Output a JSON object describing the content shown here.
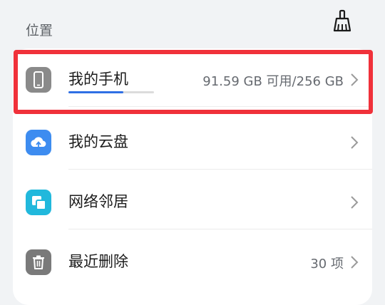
{
  "header": {
    "title": "位置",
    "clean_icon": "broom-icon"
  },
  "locations": [
    {
      "label": "我的手机",
      "icon": "phone-icon",
      "icon_color": "#8a8a8a",
      "value": "91.59 GB 可用/256 GB",
      "storage_used_fraction": 0.64,
      "highlighted": true
    },
    {
      "label": "我的云盘",
      "icon": "cloud-icon",
      "icon_color": "#3d8cf0",
      "value": ""
    },
    {
      "label": "网络邻居",
      "icon": "network-icon",
      "icon_color": "#21b8dc",
      "value": ""
    },
    {
      "label": "最近删除",
      "icon": "trash-icon",
      "icon_color": "#7a7a7a",
      "value": "30 项"
    }
  ],
  "colors": {
    "accent": "#2f6fe4",
    "highlight_border": "#f0313a"
  }
}
